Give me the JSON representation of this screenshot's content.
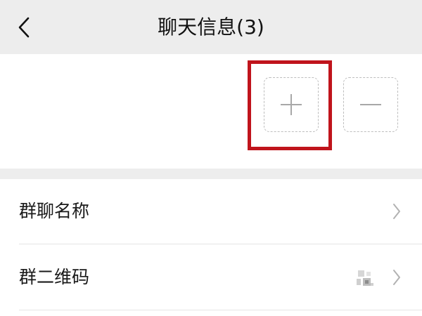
{
  "header": {
    "title": "聊天信息(3)",
    "back_icon": "chevron-left-icon"
  },
  "members": {
    "add_icon": "plus-icon",
    "remove_icon": "minus-icon",
    "highlight_color": "#c0141c"
  },
  "settings": {
    "group_name_label": "群聊名称",
    "group_qr_label": "群二维码",
    "row_icon": "chevron-right-icon"
  },
  "colors": {
    "header_bg": "#ededed",
    "row_bg": "#ffffff",
    "text": "#1a1a1a"
  }
}
